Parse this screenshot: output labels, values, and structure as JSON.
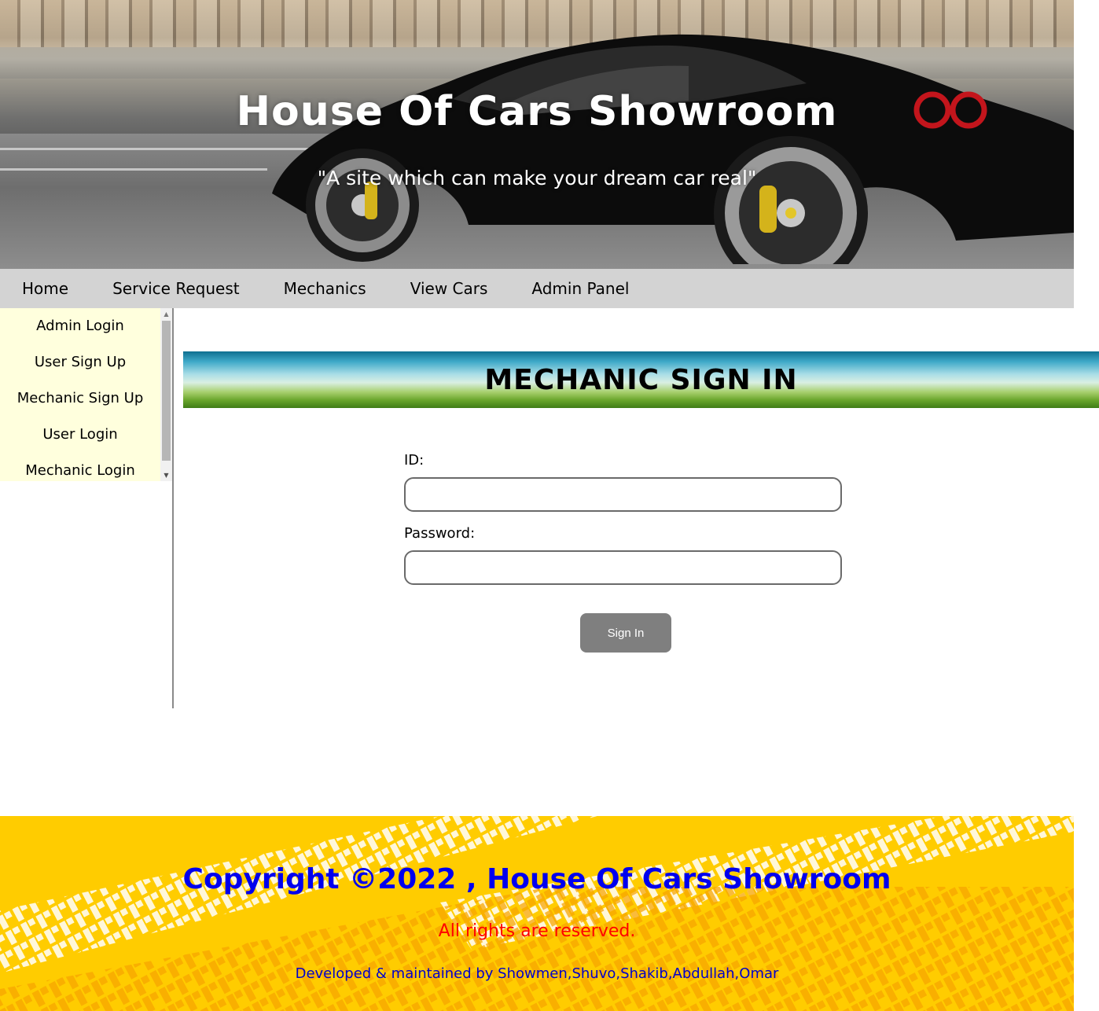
{
  "header": {
    "title": "House Of Cars Showroom",
    "tagline": "\"A site which can make your dream car real\""
  },
  "nav": {
    "items": [
      {
        "label": "Home"
      },
      {
        "label": "Service Request"
      },
      {
        "label": "Mechanics"
      },
      {
        "label": "View Cars"
      },
      {
        "label": "Admin Panel"
      }
    ]
  },
  "sidebar": {
    "items": [
      {
        "label": "Admin Login"
      },
      {
        "label": "User Sign Up"
      },
      {
        "label": "Mechanic Sign Up"
      },
      {
        "label": "User Login"
      },
      {
        "label": "Mechanic Login"
      }
    ]
  },
  "main": {
    "heading": "MECHANIC SIGN IN",
    "id_label": "ID:",
    "id_value": "",
    "password_label": "Password:",
    "password_value": "",
    "signin_label": "Sign In"
  },
  "footer": {
    "copyright": "Copyright ©2022 , House Of Cars Showroom",
    "rights": "All rights are reserved.",
    "developers": "Developed & maintained by Showmen,Shuvo,Shakib,Abdullah,Omar"
  },
  "colors": {
    "nav_bg": "#d3d3d3",
    "sidebar_bg": "#ffffdd",
    "button_bg": "#7f7f7f",
    "footer_bg": "#ffcc00",
    "copyright_color": "#0000ee",
    "rights_color": "#ff0000"
  }
}
